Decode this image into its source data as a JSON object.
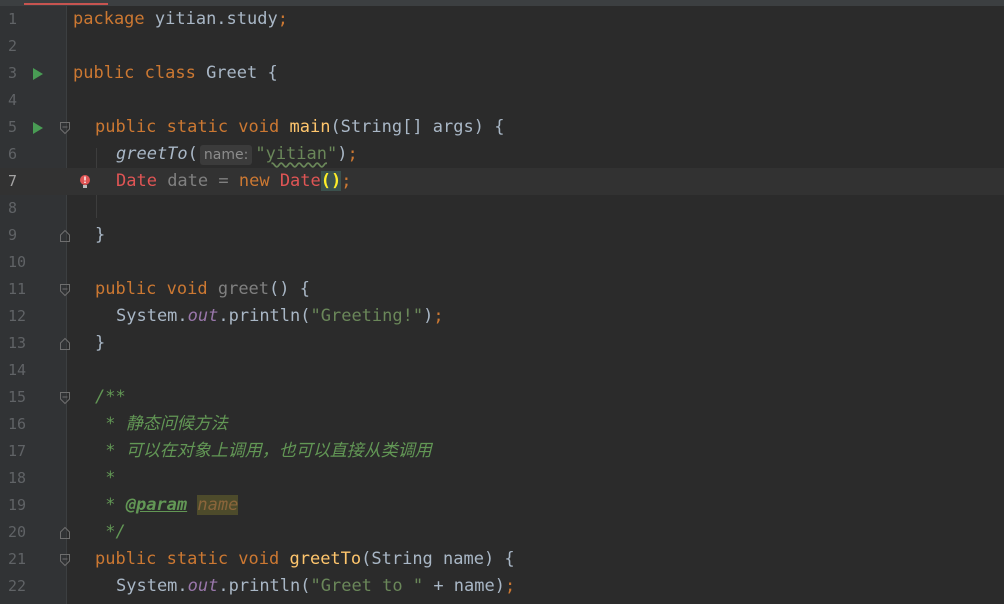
{
  "editor": {
    "current_line": 7,
    "line_numbers": [
      "1",
      "2",
      "3",
      "4",
      "5",
      "6",
      "7",
      "8",
      "9",
      "10",
      "11",
      "12",
      "13",
      "14",
      "15",
      "16",
      "17",
      "18",
      "19",
      "20",
      "21",
      "22"
    ],
    "tokens": {
      "l1_kw": "package",
      "l1_pkg": " yitian.study",
      "l1_semi": ";",
      "l3_kw": "public class",
      "l3_name": " Greet {",
      "l5_kw": "public static void",
      "l5_fn": "main",
      "l5_params": "(String[] args) {",
      "l6_call": "greetTo",
      "l6_open": "(",
      "l6_hint": "name:",
      "l6_q1": "\"",
      "l6_str": "yitian",
      "l6_q2": "\"",
      "l6_close": ")",
      "l6_semi": ";",
      "l7_type": "Date",
      "l7_var": " date = ",
      "l7_new": "new",
      "l7_ctor": "Date",
      "l7_parens": "()",
      "l7_semi": ";",
      "l9_brace": "}",
      "l11_kw": "public void",
      "l11_fn": "greet",
      "l11_rest": "() {",
      "l12_sys": "System.",
      "l12_out": "out",
      "l12_println": ".println(",
      "l12_str": "\"Greeting!\"",
      "l12_close": ")",
      "l12_semi": ";",
      "l13_brace": "}",
      "l15_doc": "/**",
      "l16_doc": " * 静态问候方法",
      "l17_doc": " * 可以在对象上调用，也可以直接从类调用",
      "l18_doc": " *",
      "l19_star": " * ",
      "l19_tag": "@param",
      "l19_name": "name",
      "l20_doc": " */",
      "l21_kw": "public static void",
      "l21_fn": "greetTo",
      "l21_params": "(String name) {",
      "l22_sys": "System.",
      "l22_out": "out",
      "l22_println": ".println(",
      "l22_str": "\"Greet to \"",
      "l22_rest": " + name)",
      "l22_semi": ";"
    }
  },
  "colors": {
    "background": "#2b2b2b",
    "keyword": "#cc7832",
    "string": "#6a8759",
    "method_decl": "#ffc66d",
    "error": "#e05555",
    "javadoc": "#629755",
    "run_icon": "#499c54"
  },
  "icons": {
    "run": "run-gutter-icon",
    "fold": "fold-marker-icon",
    "error": "error-bulb-icon"
  }
}
